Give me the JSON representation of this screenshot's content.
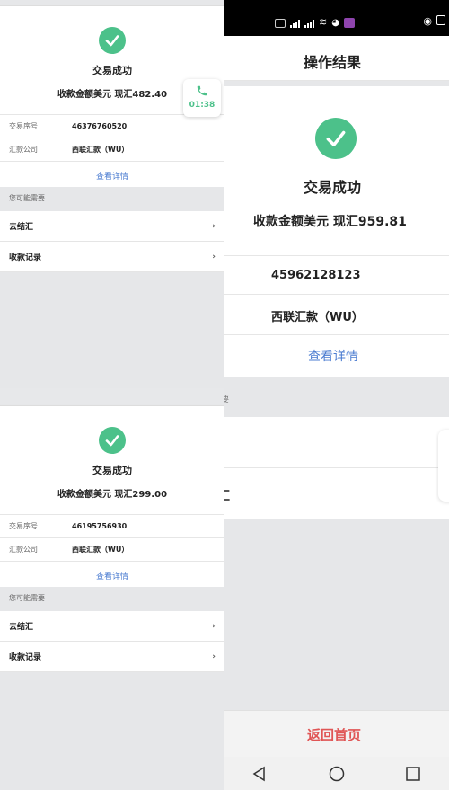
{
  "colors": {
    "success": "#4cc18a",
    "link": "#4a7bd0",
    "danger": "#e05555",
    "bg": "#e6e7e9",
    "statusbar": "#000000"
  },
  "left_top": {
    "title": "交易成功",
    "amount": "收款金额美元 现汇482.40",
    "rows": [
      {
        "label": "交易序号",
        "value": "46376760520"
      },
      {
        "label": "汇款公司",
        "value": "西联汇款（WU）"
      }
    ],
    "details_link": "查看详情",
    "section_label": "您可能需要",
    "nav": [
      {
        "label": "去结汇"
      },
      {
        "label": "收款记录"
      }
    ],
    "call_timer": "01:38"
  },
  "left_bottom": {
    "title": "交易成功",
    "amount": "收款金额美元 现汇299.00",
    "rows": [
      {
        "label": "交易序号",
        "value": "46195756930"
      },
      {
        "label": "汇款公司",
        "value": "西联汇款（WU）"
      }
    ],
    "details_link": "查看详情",
    "section_label": "您可能需要",
    "nav": [
      {
        "label": "去结汇"
      },
      {
        "label": "收款记录"
      }
    ]
  },
  "right": {
    "page_title": "操作结果",
    "title": "交易成功",
    "amount": "收款金额美元 现汇959.81",
    "serial": "45962128123",
    "company": "西联汇款（WU）",
    "details_link": "查看详情",
    "partial_section_char": "要",
    "partial_nav_char": "汇",
    "back_home": "返回首页",
    "status_icons": "5G ⁴ᴳ"
  }
}
